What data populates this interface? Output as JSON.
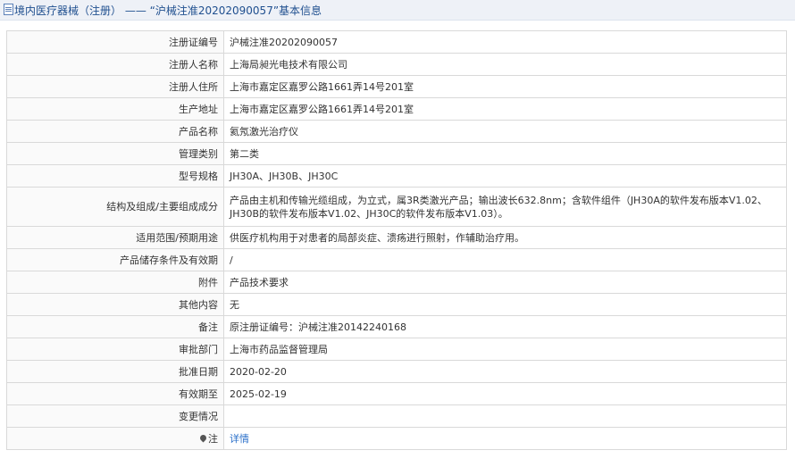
{
  "header": {
    "icon": "document-icon",
    "title": "境内医疗器械（注册） —— “沪械注准20202090057”基本信息"
  },
  "rows": [
    {
      "label": "注册证编号",
      "value": "沪械注准20202090057"
    },
    {
      "label": "注册人名称",
      "value": "上海局昶光电技术有限公司"
    },
    {
      "label": "注册人住所",
      "value": "上海市嘉定区嘉罗公路1661弄14号201室"
    },
    {
      "label": "生产地址",
      "value": "上海市嘉定区嘉罗公路1661弄14号201室"
    },
    {
      "label": "产品名称",
      "value": "氦氖激光治疗仪"
    },
    {
      "label": "管理类别",
      "value": "第二类"
    },
    {
      "label": "型号规格",
      "value": "JH30A、JH30B、JH30C"
    },
    {
      "label": "结构及组成/主要组成成分",
      "value": "产品由主机和传输光缆组成，为立式，属3R类激光产品；输出波长632.8nm；含软件组件（JH30A的软件发布版本V1.02、JH30B的软件发布版本V1.02、JH30C的软件发布版本V1.03）。"
    },
    {
      "label": "适用范围/预期用途",
      "value": "供医疗机构用于对患者的局部炎症、溃疡进行照射，作辅助治疗用。"
    },
    {
      "label": "产品储存条件及有效期",
      "value": "/"
    },
    {
      "label": "附件",
      "value": "产品技术要求"
    },
    {
      "label": "其他内容",
      "value": "无"
    },
    {
      "label": "备注",
      "value": "原注册证编号：沪械注准20142240168"
    },
    {
      "label": "审批部门",
      "value": "上海市药品监督管理局"
    },
    {
      "label": "批准日期",
      "value": "2020-02-20"
    },
    {
      "label": "有效期至",
      "value": "2025-02-19"
    },
    {
      "label": "变更情况",
      "value": ""
    }
  ],
  "note_row": {
    "icon": "pin-icon",
    "label": "注",
    "link_text": "详情"
  },
  "colors": {
    "link": "#2a6fc9",
    "header_bg": "#eef1f7",
    "border": "#d9d9d9"
  }
}
